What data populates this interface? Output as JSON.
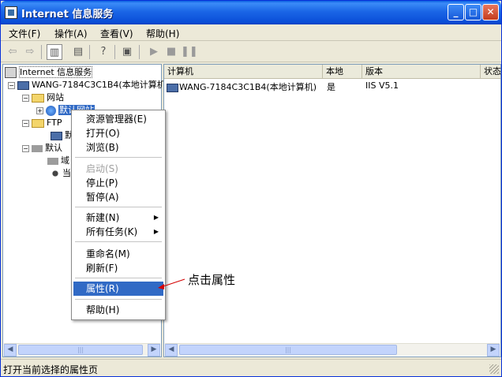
{
  "window": {
    "title": "Internet 信息服务",
    "minimize": "_",
    "maximize": "□",
    "close": "✕"
  },
  "menu": [
    "文件(F)",
    "操作(A)",
    "查看(V)",
    "帮助(H)"
  ],
  "tree": {
    "root": "Internet 信息服务",
    "computer": "WANG-7184C3C1B4(本地计算机)",
    "websites": "网站",
    "default_site": "默认网站",
    "ftp": "FTP",
    "ftp_child": "默",
    "default_smtp": "默认",
    "smtp_child1": "域",
    "smtp_child2": "当"
  },
  "list": {
    "columns": [
      "计算机",
      "本地",
      "版本",
      "状态"
    ],
    "rows": [
      {
        "computer": "WANG-7184C3C1B4(本地计算机)",
        "local": "是",
        "version": "IIS V5.1",
        "status": ""
      }
    ]
  },
  "context_menu": {
    "items": [
      {
        "label": "资源管理器(E)"
      },
      {
        "label": "打开(O)"
      },
      {
        "label": "浏览(B)"
      },
      {
        "label": "启动(S)",
        "disabled": true
      },
      {
        "label": "停止(P)"
      },
      {
        "label": "暂停(A)"
      },
      {
        "label": "新建(N)",
        "submenu": true
      },
      {
        "label": "所有任务(K)",
        "submenu": true
      },
      {
        "label": "重命名(M)"
      },
      {
        "label": "刷新(F)"
      },
      {
        "label": "属性(R)",
        "highlighted": true
      },
      {
        "label": "帮助(H)"
      }
    ]
  },
  "annotation": "点击属性",
  "status": "打开当前选择的属性页",
  "colors": {
    "selection": "#316ac5",
    "titlebar": "#0a4ed8",
    "annotation_arrow": "#d40000"
  }
}
